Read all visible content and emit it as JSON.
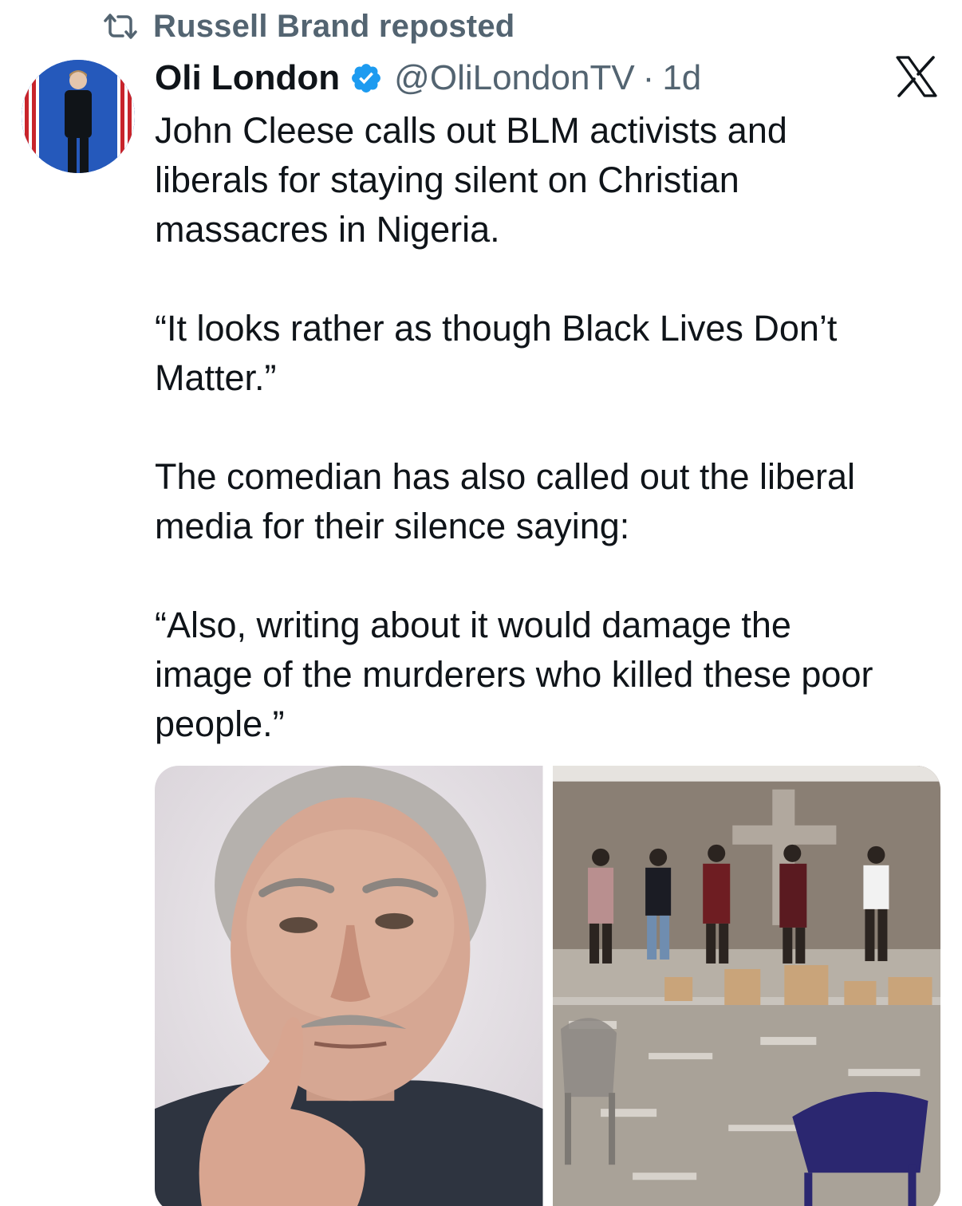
{
  "repost": {
    "icon": "repost-icon",
    "label": "Russell Brand reposted"
  },
  "author": {
    "display_name": "Oli London",
    "verified_icon": "verified-badge-icon",
    "handle": "@OliLondonTV",
    "separator": "·",
    "time": "1d",
    "avatar": "avatar"
  },
  "brand": {
    "icon": "x-logo-icon"
  },
  "tweet": {
    "paragraphs": [
      "John Cleese calls out BLM activists and\nliberals for staying silent on Christian\nmassacres in Nigeria.",
      "“It looks rather as though Black Lives Don’t\nMatter.”",
      "The comedian has also called out the liberal\nmedia for their silence saying:",
      "“Also, writing about it would damage the\nimage of the murderers who killed these poor\npeople.”"
    ]
  },
  "media": [
    {
      "name": "portrait-photo"
    },
    {
      "name": "church-ruins-photo"
    }
  ],
  "colors": {
    "text": "#0f1419",
    "secondary": "#536471",
    "verified": "#1d9bf0"
  }
}
